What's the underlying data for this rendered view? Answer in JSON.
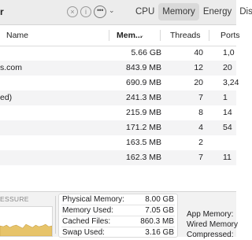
{
  "toolbar": {
    "title": "r",
    "stop_glyph": "×",
    "info_glyph": "i",
    "more_glyph": "•••",
    "chevron_glyph": "⌄",
    "tabs": [
      "CPU",
      "Memory",
      "Energy",
      "Disk"
    ],
    "active_tab": "Memory"
  },
  "columns": {
    "name": "Name",
    "memory": "Mem...",
    "threads": "Threads",
    "ports": "Ports",
    "sort_glyph": "⌄"
  },
  "rows": [
    {
      "name": "",
      "memory": "5.66 GB",
      "threads": "40",
      "ports": "1,0"
    },
    {
      "name": "s.com",
      "memory": "843.9 MB",
      "threads": "12",
      "ports": "20"
    },
    {
      "name": "",
      "memory": "690.9 MB",
      "threads": "20",
      "ports": "3,24"
    },
    {
      "name": "ed)",
      "memory": "241.3 MB",
      "threads": "7",
      "ports": "1"
    },
    {
      "name": "",
      "memory": "215.9 MB",
      "threads": "8",
      "ports": "14"
    },
    {
      "name": "",
      "memory": "171.2 MB",
      "threads": "4",
      "ports": "54"
    },
    {
      "name": "",
      "memory": "163.5 MB",
      "threads": "2",
      "ports": ""
    },
    {
      "name": "",
      "memory": "162.3 MB",
      "threads": "7",
      "ports": "11"
    }
  ],
  "bottom": {
    "pressure_label": "ESSURE",
    "pressure_color": "#e7c46a",
    "pressure_level": 0.35,
    "stats": [
      {
        "label": "Physical Memory:",
        "value": "8.00 GB"
      },
      {
        "label": "Memory Used:",
        "value": "7.05 GB"
      },
      {
        "label": "Cached Files:",
        "value": "860.3 MB"
      },
      {
        "label": "Swap Used:",
        "value": "3.16 GB"
      }
    ],
    "right": [
      "App Memory:",
      "Wired Memory",
      "Compressed:"
    ]
  }
}
